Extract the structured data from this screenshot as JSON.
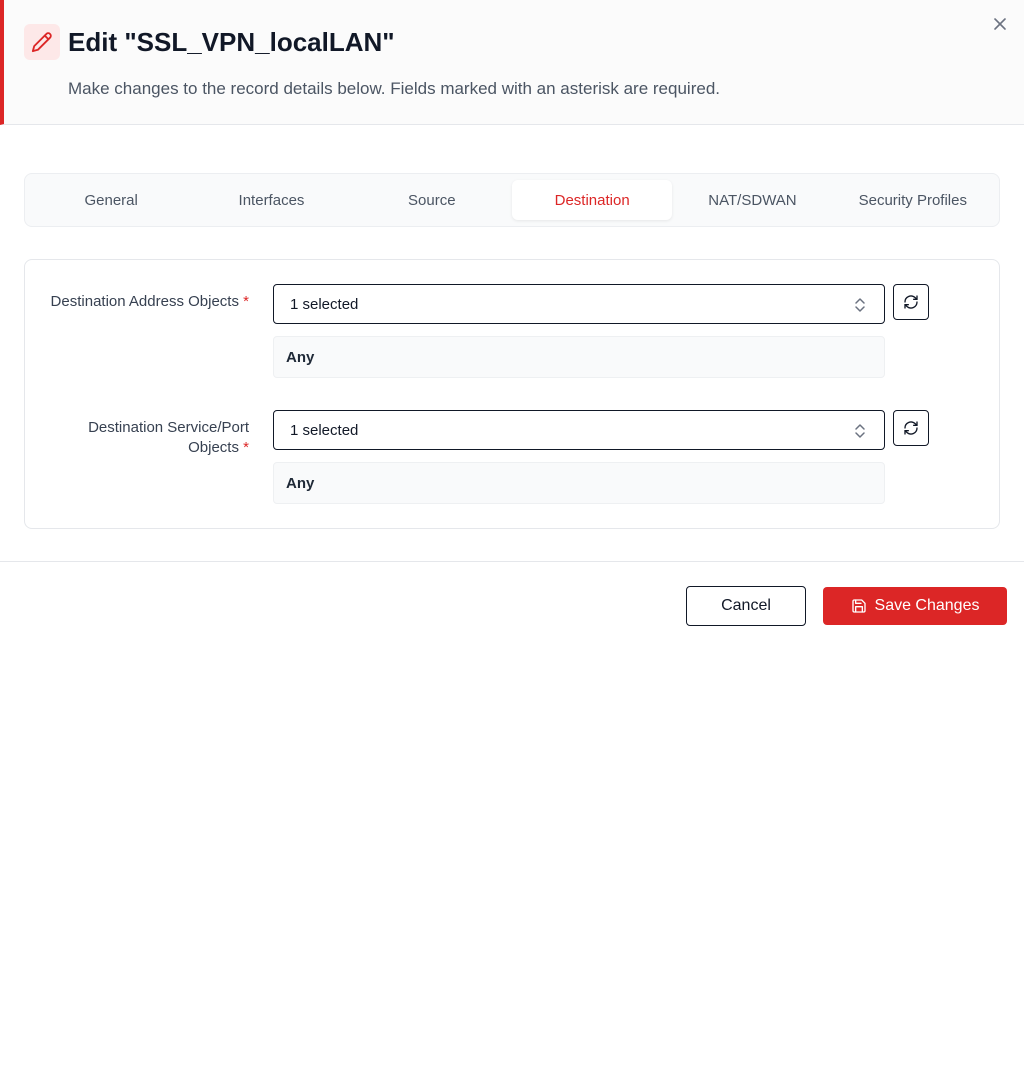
{
  "header": {
    "title": "Edit \"SSL_VPN_localLAN\"",
    "subtitle": "Make changes to the record details below. Fields marked with an asterisk are required.",
    "icon": "pencil-icon",
    "close_icon": "close-icon"
  },
  "tabs": [
    {
      "label": "General",
      "active": false
    },
    {
      "label": "Interfaces",
      "active": false
    },
    {
      "label": "Source",
      "active": false
    },
    {
      "label": "Destination",
      "active": true
    },
    {
      "label": "NAT/SDWAN",
      "active": false
    },
    {
      "label": "Security Profiles",
      "active": false
    }
  ],
  "fields": {
    "dest_address": {
      "label": "Destination Address Objects",
      "required_mark": "*",
      "select_value": "1 selected",
      "selected_items": [
        "Any"
      ]
    },
    "dest_service": {
      "label": "Destination Service/Port Objects",
      "required_mark": "*",
      "select_value": "1 selected",
      "selected_items": [
        "Any"
      ]
    }
  },
  "footer": {
    "cancel_label": "Cancel",
    "save_label": "Save Changes"
  },
  "colors": {
    "accent": "#dc2626",
    "accent_soft": "#fde8e8"
  }
}
